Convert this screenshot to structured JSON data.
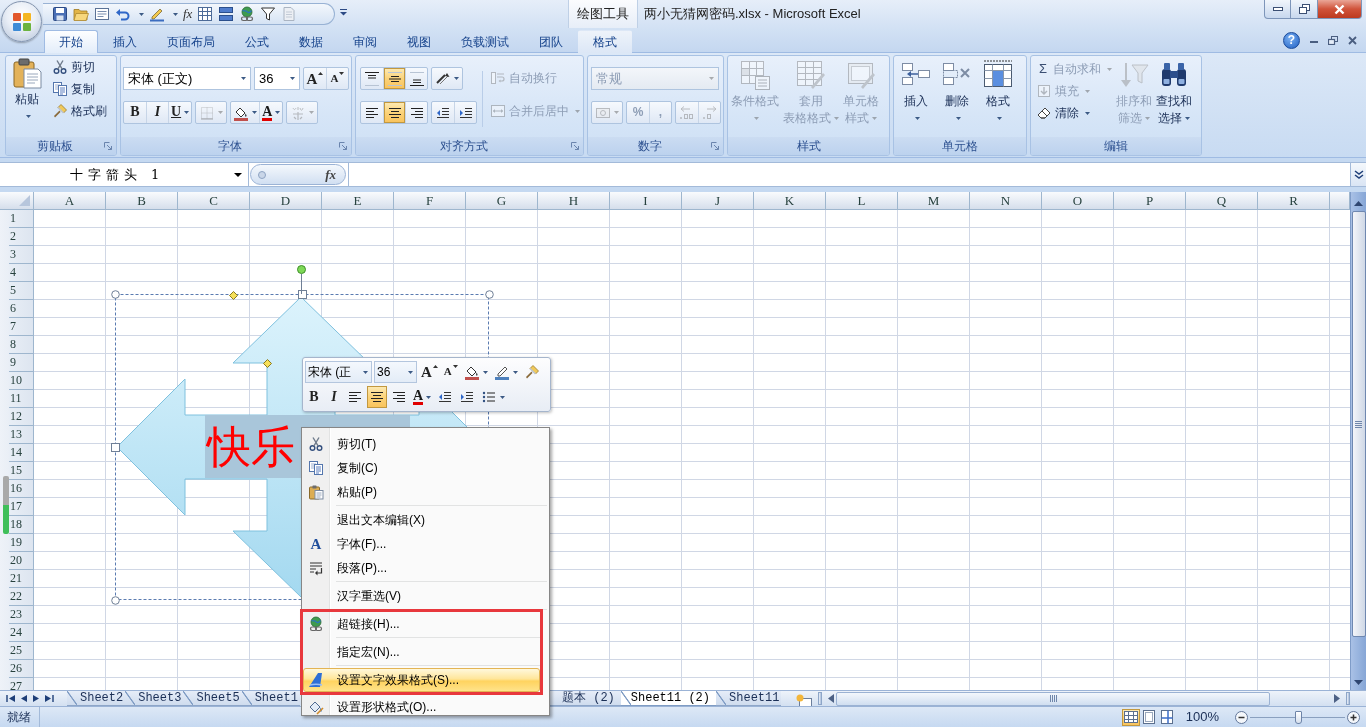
{
  "window": {
    "title": "两小无猜网密码.xlsx - Microsoft Excel",
    "contextual_group": "绘图工具"
  },
  "quick_access": {
    "function_glyph": "fx"
  },
  "tabs": [
    {
      "label": "开始",
      "selected": true,
      "contextual": false
    },
    {
      "label": "插入",
      "selected": false,
      "contextual": false
    },
    {
      "label": "页面布局",
      "selected": false,
      "contextual": false
    },
    {
      "label": "公式",
      "selected": false,
      "contextual": false
    },
    {
      "label": "数据",
      "selected": false,
      "contextual": false
    },
    {
      "label": "审阅",
      "selected": false,
      "contextual": false
    },
    {
      "label": "视图",
      "selected": false,
      "contextual": false
    },
    {
      "label": "负载测试",
      "selected": false,
      "contextual": false
    },
    {
      "label": "团队",
      "selected": false,
      "contextual": false
    },
    {
      "label": "格式",
      "selected": false,
      "contextual": true
    }
  ],
  "help": "?",
  "ribbon": {
    "clipboard": {
      "title": "剪贴板",
      "paste": "粘贴",
      "commands": [
        "剪切",
        "复制",
        "格式刷"
      ]
    },
    "font": {
      "title": "字体",
      "font_name": "宋体 (正文)",
      "font_size": "36",
      "grow": "A",
      "shrink": "A",
      "tools": [
        {
          "glyph": "B",
          "disabled": false
        },
        {
          "glyph": "I",
          "disabled": false
        },
        {
          "glyph": "U",
          "disabled": false
        },
        {
          "disabled": true
        },
        {
          "disabled": false
        },
        {
          "glyph": "A",
          "disabled": false
        },
        {
          "disabled": true
        }
      ]
    },
    "alignment": {
      "title": "对齐方式",
      "vertical": [
        {
          "selected": false
        },
        {
          "selected": true
        },
        {
          "selected": false
        }
      ],
      "horizontal": [
        {
          "selected": false
        },
        {
          "selected": true
        },
        {
          "selected": false
        }
      ],
      "wrap_text": {
        "label": "自动换行",
        "disabled": true
      },
      "merge": {
        "label": "合并后居中",
        "disabled": true
      }
    },
    "number": {
      "title": "数字",
      "format": "常规",
      "percent": "%",
      "comma": ",",
      "disabled": true
    },
    "styles": {
      "title": "样式",
      "commands": [
        {
          "lines": [
            "条件格式"
          ],
          "disabled": true
        },
        {
          "lines": [
            "套用",
            "表格格式"
          ],
          "disabled": true
        },
        {
          "lines": [
            "单元格",
            "样式"
          ],
          "disabled": true
        }
      ]
    },
    "cells": {
      "title": "单元格",
      "commands": [
        {
          "label": "插入",
          "disabled": false
        },
        {
          "label": "删除",
          "disabled": false
        },
        {
          "label": "格式",
          "disabled": false
        }
      ]
    },
    "editing": {
      "title": "编辑",
      "commands": [
        {
          "label": "自动求和",
          "glyph": "Σ",
          "disabled": true
        },
        {
          "label": "填充",
          "disabled": true
        },
        {
          "label": "清除",
          "disabled": false
        }
      ],
      "large": [
        {
          "lines": [
            "排序和",
            "筛选"
          ],
          "disabled": true
        },
        {
          "lines": [
            "查找和",
            "选择"
          ],
          "disabled": false
        }
      ]
    }
  },
  "formula_bar": {
    "name_box": "十字箭头 1",
    "function_glyph": "fx"
  },
  "sheet": {
    "columns": [
      "A",
      "B",
      "C",
      "D",
      "E",
      "F",
      "G",
      "H",
      "I",
      "J",
      "K",
      "L",
      "M",
      "N",
      "O",
      "P",
      "Q",
      "R"
    ],
    "rows": [
      "1",
      "2",
      "3",
      "4",
      "5",
      "6",
      "7",
      "8",
      "9",
      "10",
      "11",
      "12",
      "13",
      "14",
      "15",
      "16",
      "17",
      "18",
      "19",
      "20",
      "21",
      "22",
      "23",
      "24",
      "25",
      "26",
      "27"
    ]
  },
  "shape": {
    "text": "快乐",
    "selected": true
  },
  "mini_toolbar": {
    "font_name": "宋体 (正",
    "font_size": "36",
    "grow": "A",
    "shrink": "A",
    "bold": "B",
    "italic": "I",
    "font_color": "A",
    "alignment": [
      {
        "selected": false
      },
      {
        "selected": true
      },
      {
        "selected": false
      }
    ]
  },
  "context_menu": [
    {
      "kind": "item",
      "label": "剪切(T)",
      "selected": false,
      "framed": false
    },
    {
      "kind": "item",
      "label": "复制(C)",
      "selected": false,
      "framed": false
    },
    {
      "kind": "item",
      "label": "粘贴(P)",
      "selected": false,
      "framed": false
    },
    {
      "kind": "separator"
    },
    {
      "kind": "item",
      "label": "退出文本编辑(X)",
      "selected": false,
      "framed": false
    },
    {
      "kind": "item",
      "label": "字体(F)...",
      "glyph": "A",
      "selected": false,
      "framed": false
    },
    {
      "kind": "item",
      "label": "段落(P)...",
      "selected": false,
      "framed": false
    },
    {
      "kind": "separator"
    },
    {
      "kind": "item",
      "label": "汉字重选(V)",
      "selected": false,
      "framed": false
    },
    {
      "kind": "separator"
    },
    {
      "kind": "item",
      "label": "超链接(H)...",
      "selected": false,
      "framed": true
    },
    {
      "kind": "separator"
    },
    {
      "kind": "item",
      "label": "指定宏(N)...",
      "selected": false,
      "framed": true
    },
    {
      "kind": "separator"
    },
    {
      "kind": "item",
      "label": "设置文字效果格式(S)...",
      "selected": true,
      "framed": true
    },
    {
      "kind": "item",
      "label": "设置形状格式(O)...",
      "selected": false,
      "framed": false
    }
  ],
  "sheet_tabs": [
    {
      "label": "Sheet2",
      "selected": false
    },
    {
      "label": "Sheet3",
      "selected": false
    },
    {
      "label": "Sheet5",
      "selected": false
    },
    {
      "label": "Sheet1",
      "selected": false
    },
    {
      "label": "题本 (2)",
      "selected": false
    },
    {
      "label": "Sheet11 (2)",
      "selected": true
    },
    {
      "label": "Sheet11",
      "selected": false
    }
  ],
  "status_bar": {
    "text": "就绪",
    "views": [
      {
        "selected": true
      },
      {
        "selected": false
      },
      {
        "selected": false
      }
    ],
    "zoom": "100%",
    "zoom_slider": {
      "level": 0.5
    }
  }
}
